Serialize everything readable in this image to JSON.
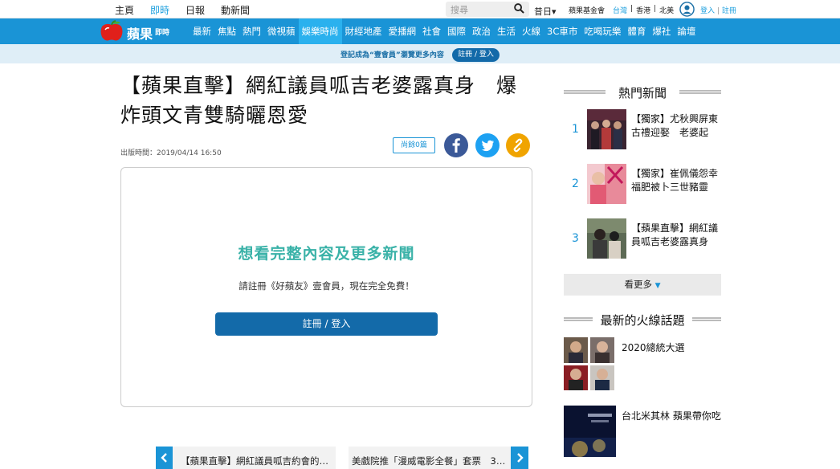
{
  "topbar": {
    "nav": [
      "主頁",
      "即時",
      "日報",
      "動新聞"
    ],
    "search_placeholder": "搜尋",
    "today": "昔日▾",
    "foundation": "蘋果基金會",
    "regions": [
      "台灣",
      "|",
      "香港",
      "|",
      "北美"
    ],
    "login": "登入",
    "sep": "|",
    "register": "註冊"
  },
  "brand": {
    "name": "蘋果",
    "sub": "即時"
  },
  "mainnav": [
    "最新",
    "焦點",
    "熱門",
    "微視蘋",
    "娛樂時尚",
    "財經地產",
    "愛播網",
    "社會",
    "國際",
    "政治",
    "生活",
    "火線",
    "3C車市",
    "吃喝玩樂",
    "體育",
    "爆社",
    "論壇"
  ],
  "mainnav_active": "娛樂時尚",
  "promo": {
    "text": "登記成為“壹會員”瀏覽更多內容",
    "button": "註冊 / 登入"
  },
  "article": {
    "title": "【蘋果直擊】網紅議員呱吉老婆露真身　爆炸頭文青雙騎曬恩愛",
    "published": "出版時間：2019/04/14 16:50",
    "count_button": "尚餘0篇"
  },
  "paywall": {
    "title": "想看完整內容及更多新聞",
    "text": "請註冊《好蘋友》壹會員，現在完全免費！",
    "button": "註冊 / 登入"
  },
  "pager": {
    "prev": "【蘋果直擊】網紅議員呱吉約會的…",
    "next": "美戲院推「漫威電影全餐」套票　3…"
  },
  "sidebar": {
    "hot_title": "熱門新聞",
    "hot": [
      {
        "num": "1",
        "text": "【獨家】尤秋興屏東古禮迎娶　老婆起"
      },
      {
        "num": "2",
        "text": "【獨家】崔佩儀怨幸福肥被卜三世豬靈"
      },
      {
        "num": "3",
        "text": "【蘋果直擊】網紅議員呱吉老婆露真身"
      }
    ],
    "more": "看更多",
    "topics_title": "最新的火線話題",
    "topics": [
      {
        "text": "2020總統大選"
      },
      {
        "text": "台北米其林 蘋果帶你吃"
      }
    ]
  },
  "colors": {
    "brand": "#1a94d6",
    "accent": "#2ab1ee",
    "button": "#136aa9",
    "paywall_title": "#3ab2a8"
  }
}
